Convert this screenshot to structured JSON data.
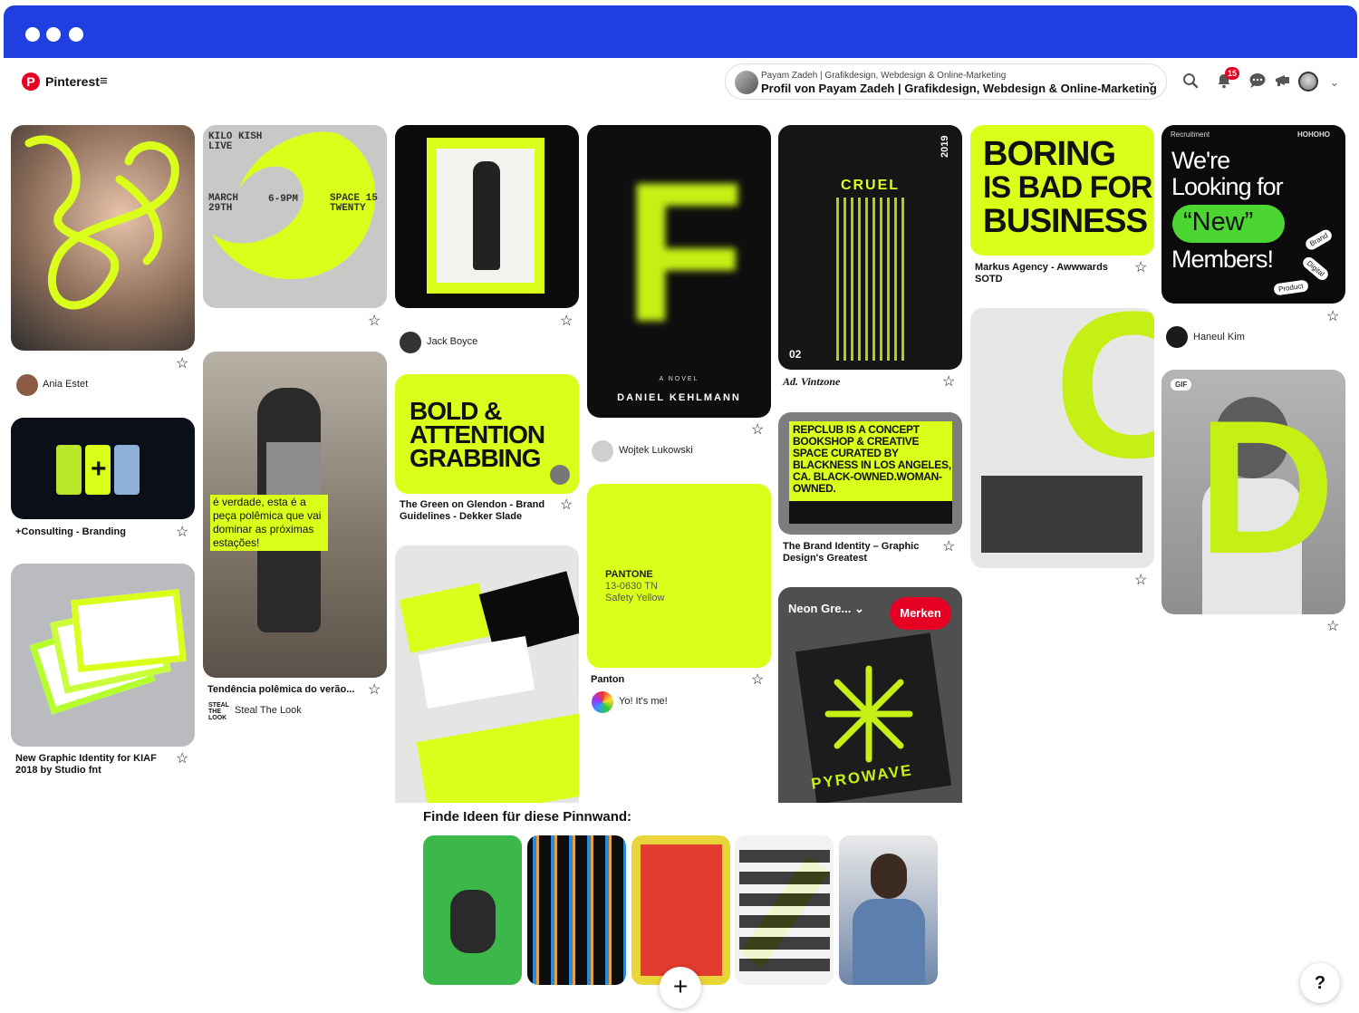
{
  "header": {
    "brand": "Pinterest",
    "menu_icon": "hamburger-icon",
    "profile_sub": "Payam Zadeh | Grafikdesign, Webdesign & Online-Marketing",
    "profile_main": "Profil von Payam Zadeh | Grafikdesign, Webdesign & Online-Marketing",
    "notification_count": "15",
    "icons": [
      "search-icon",
      "bell-icon",
      "chat-icon",
      "megaphone-icon",
      "avatar",
      "chevron-down-icon"
    ]
  },
  "colors": {
    "accent": "#e60023",
    "chrome": "#1f3fe0",
    "neon": "#d9ff1a"
  },
  "pins": {
    "p1": {
      "user": "Ania Estet"
    },
    "p2": {
      "title": "+Consulting - Branding"
    },
    "p3": {
      "title": "New Graphic Identity for KIAF 2018 by Studio fnt"
    },
    "p4": {
      "l1": "KILO KISH",
      "l2": "LIVE",
      "l3": "MARCH",
      "l4": "29TH",
      "l5": "6-9PM",
      "l6": "SPACE 15",
      "l7": "TWENTY"
    },
    "p5": {
      "title": "Tendência polêmica do verão...",
      "user": "Steal The Look",
      "overlay": "é verdade, esta é a peça polêmica que vai dominar as próximas estações!"
    },
    "p6": {
      "user": "Jack Boyce"
    },
    "p7": {
      "title": "The Green on Glendon - Brand Guidelines - Dekker Slade",
      "overlay": "BOLD & ATTENTION GRABBING"
    },
    "p8": {
      "letter": "F",
      "overline": "A NOVEL",
      "author": "DANIEL KEHLMANN",
      "user": "Wojtek Lukowski"
    },
    "p9": {
      "title": "Panton",
      "user": "Yo! It's me!",
      "brand": "PANTONE",
      "code": "13-0630 TN",
      "name": "Safety Yellow"
    },
    "p10": {
      "title": "Ad. Vintzone",
      "word": "CRUEL",
      "year": "2019",
      "num": "02"
    },
    "p11": {
      "title": "The Brand Identity – Graphic Design's Greatest",
      "overlay": "REPCLUB IS A CONCEPT BOOKSHOP & CREATIVE SPACE CURATED BY BLACKNESS IN LOS ANGELES, CA. BLACK-OWNED.WOMAN-OWNED."
    },
    "p12": {
      "board": "Neon Gre...",
      "save": "Merken",
      "word": "PYROWAVE"
    },
    "p13": {
      "title": "Markus Agency - Awwwards SOTD",
      "l1": "BORING",
      "l2": "IS BAD FOR",
      "l3": "BUSINESS"
    },
    "p14": {
      "letter": "C"
    },
    "p15": {
      "user": "Haneul Kim",
      "top_left": "Recruitment",
      "top_right": "HOHOHO",
      "l1": "We're",
      "l2": "Looking for",
      "l3": "“New”",
      "l4": "Members!",
      "tag1": "Brand",
      "tag2": "Digital",
      "tag3": "Product"
    },
    "p16": {
      "gif": "GIF",
      "letter": "D"
    }
  },
  "ideas": {
    "title": "Finde Ideen für diese Pinnwand:"
  },
  "buttons": {
    "plus": "+",
    "help": "?"
  }
}
